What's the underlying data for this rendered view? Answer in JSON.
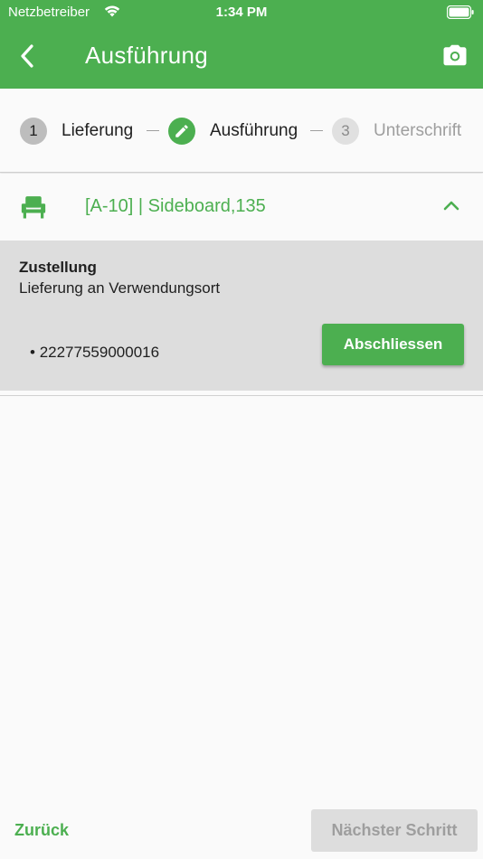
{
  "status_bar": {
    "carrier": "Netzbetreiber",
    "time": "1:34 PM"
  },
  "app_bar": {
    "title": "Ausführung",
    "back_icon": "chevron-left-icon",
    "camera_icon": "camera-icon",
    "background_color": "#4caf50"
  },
  "stepper": {
    "steps": [
      {
        "number": "1",
        "label": "Lieferung",
        "state": "done"
      },
      {
        "number": "",
        "label": "Ausführung",
        "state": "active",
        "icon": "pencil-icon"
      },
      {
        "number": "3",
        "label": "Unterschrift",
        "state": "pending"
      }
    ]
  },
  "section": {
    "icon": "chair-icon",
    "title": "[A-10]  | Sideboard,135",
    "toggle_icon": "chevron-up-icon"
  },
  "delivery": {
    "title": "Zustellung",
    "subtitle": "Lieferung an Verwendungsort",
    "items": [
      "22277559000016"
    ],
    "complete_label": "Abschliessen"
  },
  "footer": {
    "back_label": "Zurück",
    "next_label": "Nächster Schritt"
  },
  "colors": {
    "accent": "#4caf50",
    "panel": "#dddddd",
    "disabled_text": "#9e9e9e"
  }
}
